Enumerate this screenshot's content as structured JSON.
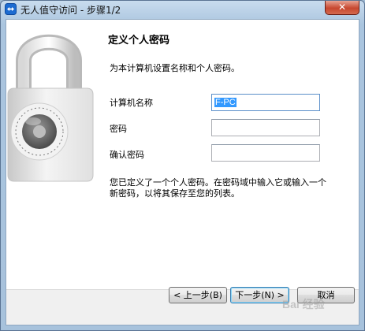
{
  "window": {
    "title": "无人值守访问 - 步骤1/2",
    "close_label": "✕"
  },
  "page": {
    "heading": "定义个人密码",
    "subtitle": "为本计算机设置名称和个人密码。",
    "description": "您已定义了一个个人密码。在密码域中输入它或输入一个新密码，以将其保存至您的列表。"
  },
  "form": {
    "computer_name_label": "计算机名称",
    "computer_name_value": "F-PC",
    "password_label": "密码",
    "password_value": "",
    "confirm_password_label": "确认密码",
    "confirm_password_value": ""
  },
  "buttons": {
    "back": "< 上一步(B)",
    "next": "下一步(N) >",
    "cancel": "取消"
  },
  "watermark": "Bai 经验"
}
